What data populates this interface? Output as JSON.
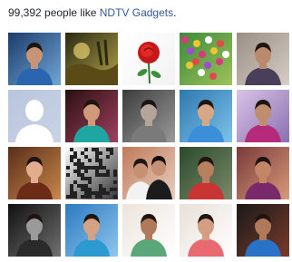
{
  "likes": {
    "count_text": "99,392 people like ",
    "page_name": "NDTV Gadgets",
    "suffix": "."
  },
  "colors": {
    "link": "#365899",
    "text": "#1d2129",
    "default_avatar_bg": "#b8c5dc"
  },
  "faces": [
    {
      "name": "profile-photo-1",
      "bg": [
        "#1b3c6a",
        "#6fa6d6"
      ],
      "subject": "person",
      "skin": "#c89478",
      "shirt": "#2a66b0"
    },
    {
      "name": "profile-photo-2",
      "bg": [
        "#2a2a12",
        "#b3a24a"
      ],
      "subject": "landscape"
    },
    {
      "name": "profile-photo-3",
      "bg": [
        "#ffffff",
        "#f2f2f2"
      ],
      "subject": "rose"
    },
    {
      "name": "profile-photo-4",
      "bg": [
        "#3a8a3a",
        "#9ec25a"
      ],
      "subject": "flowers"
    },
    {
      "name": "profile-photo-5",
      "bg": [
        "#9a8f86",
        "#d6cdc4"
      ],
      "subject": "person",
      "skin": "#b98a6c",
      "shirt": "#4a3f5a"
    },
    {
      "name": "profile-photo-6",
      "bg": [
        "#b8c5dc",
        "#c9d3e6"
      ],
      "subject": "default-avatar"
    },
    {
      "name": "profile-photo-7",
      "bg": [
        "#2a1010",
        "#a04060"
      ],
      "subject": "person",
      "skin": "#d09a7a",
      "shirt": "#1fa6a0"
    },
    {
      "name": "profile-photo-8",
      "bg": [
        "#3c3c3c",
        "#9a9a9a"
      ],
      "subject": "person",
      "skin": "#b4a49a",
      "shirt": "#7a7a7a"
    },
    {
      "name": "profile-photo-9",
      "bg": [
        "#2f78b0",
        "#7cc3e8"
      ],
      "subject": "person",
      "skin": "#d8a886",
      "shirt": "#3a8fd8"
    },
    {
      "name": "profile-photo-10",
      "bg": [
        "#d9c4e6",
        "#8a6fb0"
      ],
      "subject": "person",
      "skin": "#c08e6e",
      "shirt": "#b52a7a"
    },
    {
      "name": "profile-photo-11",
      "bg": [
        "#5a2e1a",
        "#c9874a"
      ],
      "subject": "person",
      "skin": "#e2ad8c",
      "shirt": "#6b2b16"
    },
    {
      "name": "profile-photo-12",
      "bg": [
        "#ffffff",
        "#333333"
      ],
      "subject": "qr"
    },
    {
      "name": "profile-photo-13",
      "bg": [
        "#c07a5a",
        "#e8d0c0"
      ],
      "subject": "couple",
      "skin": "#c69074",
      "shirt": "#1c1c1c"
    },
    {
      "name": "profile-photo-14",
      "bg": [
        "#2a4a2a",
        "#7a8a6a"
      ],
      "subject": "person",
      "skin": "#b98060",
      "shirt": "#c93434"
    },
    {
      "name": "profile-photo-15",
      "bg": [
        "#7a3a3a",
        "#d89a7a"
      ],
      "subject": "person",
      "skin": "#c28666",
      "shirt": "#7a2a6a"
    },
    {
      "name": "profile-photo-16",
      "bg": [
        "#101010",
        "#707070"
      ],
      "subject": "person",
      "skin": "#9a9a9a",
      "shirt": "#2a2a2a"
    },
    {
      "name": "profile-photo-17",
      "bg": [
        "#2c7ac0",
        "#8fc6ee"
      ],
      "subject": "person",
      "skin": "#d4a282",
      "shirt": "#2a9ad0"
    },
    {
      "name": "profile-photo-18",
      "bg": [
        "#ece4dc",
        "#ffffff"
      ],
      "subject": "person",
      "skin": "#b07a5a",
      "shirt": "#5aa87a"
    },
    {
      "name": "profile-photo-19",
      "bg": [
        "#e8e0d8",
        "#ffffff"
      ],
      "subject": "person",
      "skin": "#d49e82",
      "shirt": "#e86a70"
    },
    {
      "name": "profile-photo-20",
      "bg": [
        "#1a1a1a",
        "#7a3a2a"
      ],
      "subject": "person",
      "skin": "#b07a5a",
      "shirt": "#2a72c8"
    }
  ]
}
